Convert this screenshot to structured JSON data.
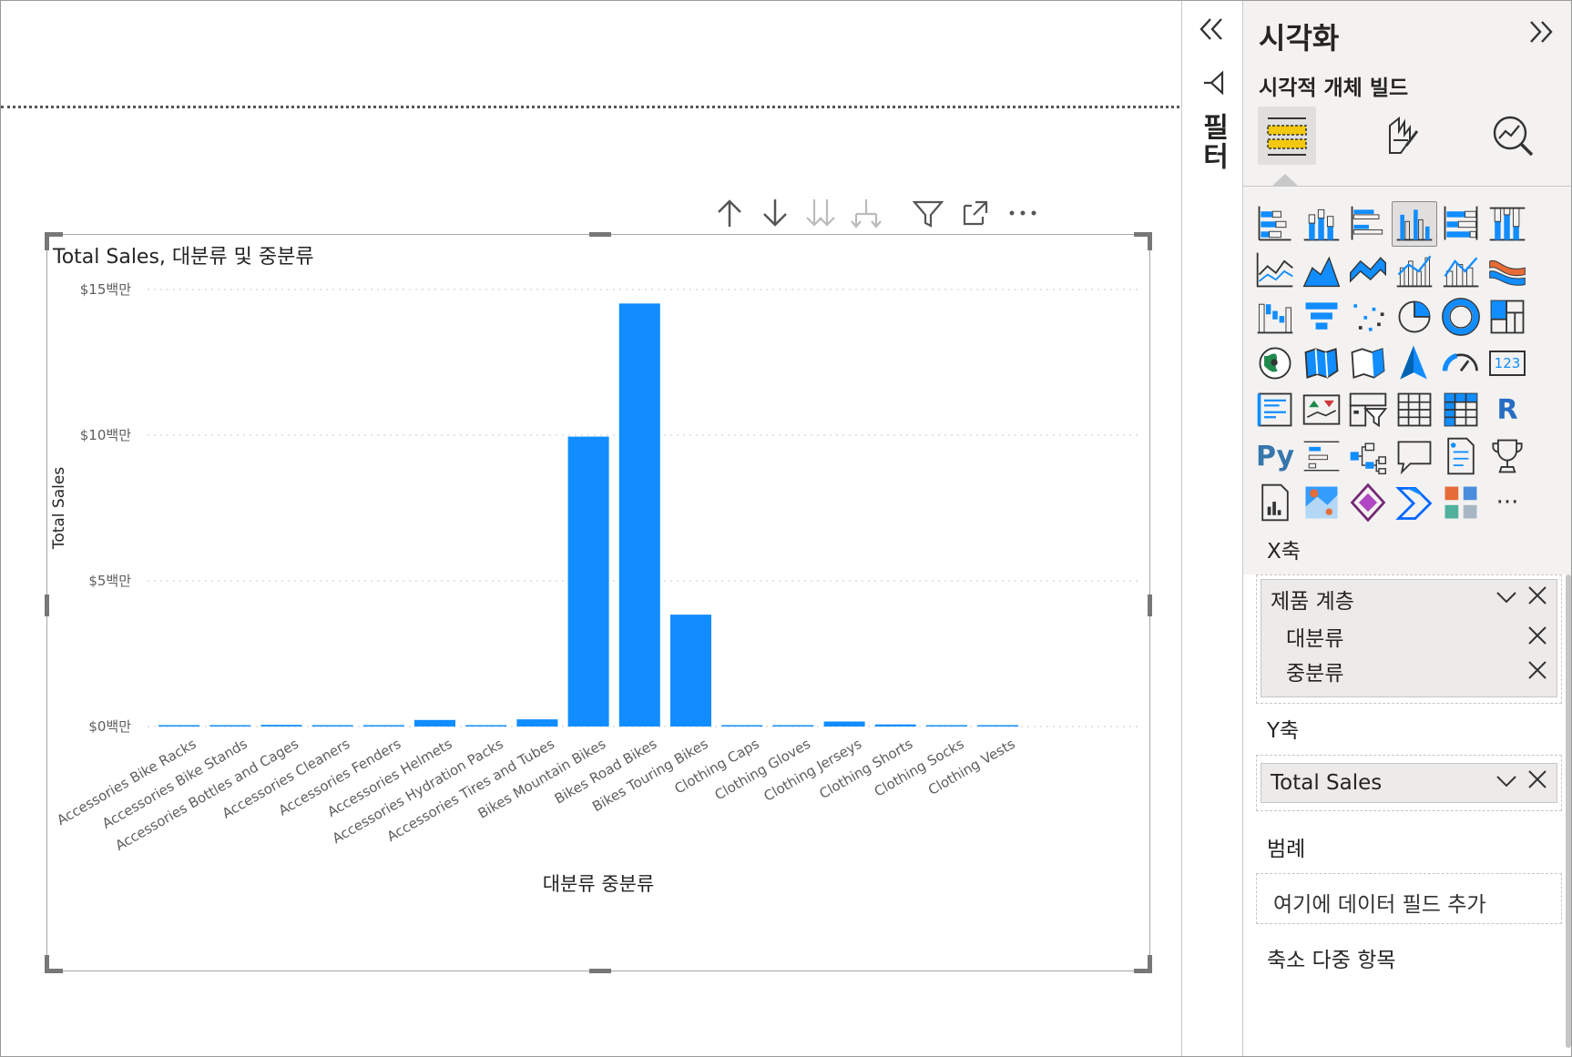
{
  "visual": {
    "title": "Total Sales, 대분류 및 중분류",
    "toolbar": [
      "drill-up-icon",
      "drill-down-icon",
      "expand-next-level-icon",
      "expand-hierarchy-icon",
      "filter-icon",
      "focus-mode-icon",
      "more-options-icon"
    ]
  },
  "chart_data": {
    "type": "bar",
    "title": "Total Sales, 대분류 및 중분류",
    "xlabel": "대분류 중분류",
    "ylabel": "Total Sales",
    "ylim": [
      0,
      15000000
    ],
    "yticks": [
      {
        "value": 0,
        "label": "$0백만"
      },
      {
        "value": 5000000,
        "label": "$5백만"
      },
      {
        "value": 10000000,
        "label": "$10백만"
      },
      {
        "value": 15000000,
        "label": "$15백만"
      }
    ],
    "categories": [
      "Accessories Bike Racks",
      "Accessories Bike Stands",
      "Accessories Bottles and Cages",
      "Accessories Cleaners",
      "Accessories Fenders",
      "Accessories Helmets",
      "Accessories Hydration Packs",
      "Accessories Tires and Tubes",
      "Bikes Mountain Bikes",
      "Bikes Road Bikes",
      "Bikes Touring Bikes",
      "Clothing Caps",
      "Clothing Gloves",
      "Clothing Jerseys",
      "Clothing Shorts",
      "Clothing Socks",
      "Clothing Vests"
    ],
    "values": [
      40000,
      40000,
      56000,
      7000,
      46000,
      225000,
      40000,
      246000,
      9950000,
      14520000,
      3840000,
      20000,
      35000,
      172000,
      72000,
      5000,
      35000
    ],
    "color": "#118dff",
    "grid": true
  },
  "filter_pane": {
    "label": "필터"
  },
  "viz_pane": {
    "title": "시각화",
    "build_label": "시각적 개체 빌드",
    "modes": [
      "build-visual-icon",
      "format-visual-icon",
      "analytics-icon"
    ],
    "visual_types": [
      "stacked-bar-chart-icon",
      "stacked-column-chart-icon",
      "clustered-bar-chart-icon",
      "clustered-column-chart-icon",
      "100-stacked-bar-chart-icon",
      "100-stacked-column-chart-icon",
      "line-chart-icon",
      "area-chart-icon",
      "stacked-area-chart-icon",
      "line-clustered-column-chart-icon",
      "line-stacked-column-chart-icon",
      "ribbon-chart-icon",
      "waterfall-chart-icon",
      "funnel-icon",
      "scatter-chart-icon",
      "pie-chart-icon",
      "donut-chart-icon",
      "treemap-icon",
      "map-icon",
      "filled-map-icon",
      "shape-map-icon",
      "azure-map-icon",
      "gauge-icon",
      "card-icon",
      "multi-row-card-icon",
      "kpi-icon",
      "slicer-icon",
      "table-icon",
      "matrix-icon",
      "r-visual-icon",
      "python-visual-icon",
      "key-influencers-icon",
      "decomposition-tree-icon",
      "qa-icon",
      "smart-narrative-icon",
      "metrics-icon",
      "paginated-report-icon",
      "arcgis-map-icon",
      "power-apps-icon",
      "power-automate-icon",
      "get-more-visuals-icon",
      "more-visuals-icon"
    ],
    "r_glyph": "R",
    "py_glyph": "Py",
    "card_glyph": "123",
    "more_glyph": "···",
    "wells": {
      "x_axis": {
        "title": "X축",
        "field": "제품 계층",
        "subfields": [
          "대분류",
          "중분류"
        ]
      },
      "y_axis": {
        "title": "Y축",
        "field": "Total Sales"
      },
      "legend": {
        "title": "범례",
        "placeholder": "여기에 데이터 필드 추가"
      },
      "small_multiples": {
        "title": "축소 다중 항목"
      }
    }
  }
}
